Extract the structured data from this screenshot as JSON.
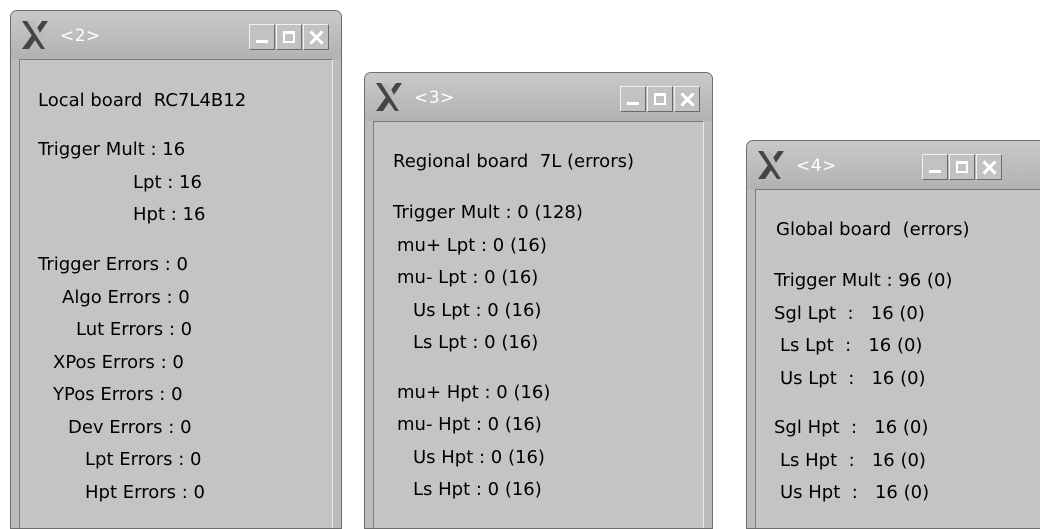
{
  "windows": [
    {
      "title": "<2>",
      "board_header": "Local board  RC7L4B12",
      "trigger_lines": [
        "Trigger Mult : 16",
        "Lpt : 16",
        "Hpt : 16"
      ],
      "error_lines": [
        "Trigger Errors : 0",
        "Algo Errors : 0",
        "Lut Errors : 0",
        "XPos Errors : 0",
        "YPos Errors : 0",
        "Dev Errors : 0",
        "Lpt Errors : 0",
        "Hpt Errors : 0"
      ]
    },
    {
      "title": "<3>",
      "board_header": "Regional board  7L (errors)",
      "lpt_lines": [
        "Trigger Mult : 0 (128)",
        "mu+ Lpt : 0 (16)",
        "mu- Lpt : 0 (16)",
        "Us Lpt : 0 (16)",
        "Ls Lpt : 0 (16)"
      ],
      "hpt_lines": [
        "mu+ Hpt : 0 (16)",
        "mu- Hpt : 0 (16)",
        "Us Hpt : 0 (16)",
        "Ls Hpt : 0 (16)"
      ]
    },
    {
      "title": "<4>",
      "board_header": "Global board  (errors)",
      "lpt_lines": [
        "Trigger Mult : 96 (0)",
        "Sgl Lpt  :   16 (0)",
        "Ls Lpt  :   16 (0)",
        "Us Lpt  :   16 (0)"
      ],
      "hpt_lines": [
        "Sgl Hpt  :   16 (0)",
        "Ls Hpt  :   16 (0)",
        "Us Hpt  :   16 (0)"
      ]
    }
  ],
  "icons": {
    "window_logo": "x-window-logo-icon",
    "minimize": "minimize-icon",
    "maximize": "maximize-icon",
    "close": "close-icon"
  },
  "colors": {
    "window_bg": "#bcbcbc",
    "title_text": "#ffffff",
    "content_text": "#000000"
  }
}
